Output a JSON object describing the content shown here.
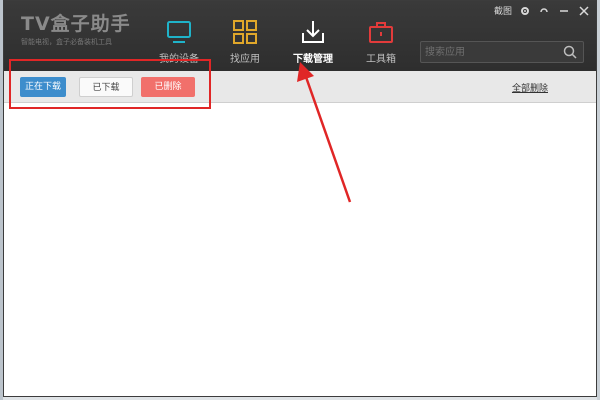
{
  "app": {
    "title": "TV盒子助手",
    "subtitle": "智能电视，盒子必备装机工具"
  },
  "nav": [
    {
      "label": "我的设备",
      "icon": "tv-icon",
      "color": "#1fb3c9"
    },
    {
      "label": "找应用",
      "icon": "grid-icon",
      "color": "#e0a72a"
    },
    {
      "label": "下载管理",
      "icon": "download-icon",
      "color": "#ffffff"
    },
    {
      "label": "工具箱",
      "icon": "toolbox-icon",
      "color": "#e23b3b"
    }
  ],
  "active_nav": "下载管理",
  "search": {
    "placeholder": "搜索应用"
  },
  "window_controls": {
    "feedback": "截图"
  },
  "tabs": {
    "downloading": "正在下载",
    "downloaded": "已下载",
    "deleted": "已删除"
  },
  "actions": {
    "clear_all": "全部删除"
  },
  "colors": {
    "titlebar": "#333333",
    "tab_active": "#3d8dcc",
    "tab_deleted": "#f1706b",
    "annotation": "#e02626"
  }
}
